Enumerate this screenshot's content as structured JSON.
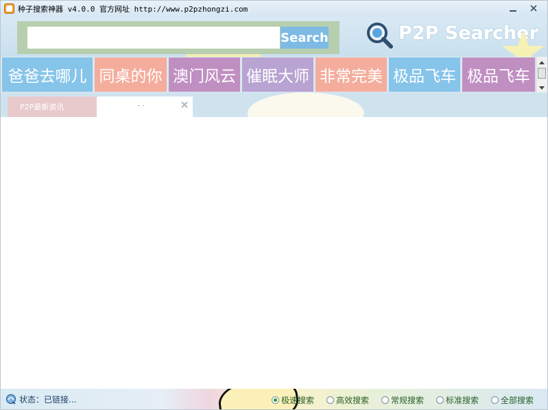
{
  "window": {
    "title_app": "种子搜索神器",
    "title_version": "v4.0.0",
    "title_site_label": "官方网址",
    "title_url": "http://www.p2pzhongzi.com"
  },
  "search": {
    "value": "",
    "button_label": "Search"
  },
  "brand": "P2P Searcher",
  "hot_tiles": [
    {
      "label": "爸爸去哪儿",
      "color": "#86c4ea"
    },
    {
      "label": "同桌的你",
      "color": "#f4ad9c"
    },
    {
      "label": "澳门风云",
      "color": "#c08fc2"
    },
    {
      "label": "催眠大师",
      "color": "#b8a3d2"
    },
    {
      "label": "非常完美",
      "color": "#f4ad9c"
    },
    {
      "label": "极品飞车",
      "color": "#86c4ea"
    },
    {
      "label": "极品飞车",
      "color": "#c08fc2"
    }
  ],
  "tabs": {
    "news_label": "P2P最新资讯",
    "blank_label": ". ."
  },
  "status": {
    "text": "状态：已链接..."
  },
  "search_modes": [
    {
      "label": "极速搜索",
      "selected": true
    },
    {
      "label": "高效搜索",
      "selected": false
    },
    {
      "label": "常规搜索",
      "selected": false
    },
    {
      "label": "标准搜索",
      "selected": false
    },
    {
      "label": "全部搜索",
      "selected": false
    }
  ]
}
